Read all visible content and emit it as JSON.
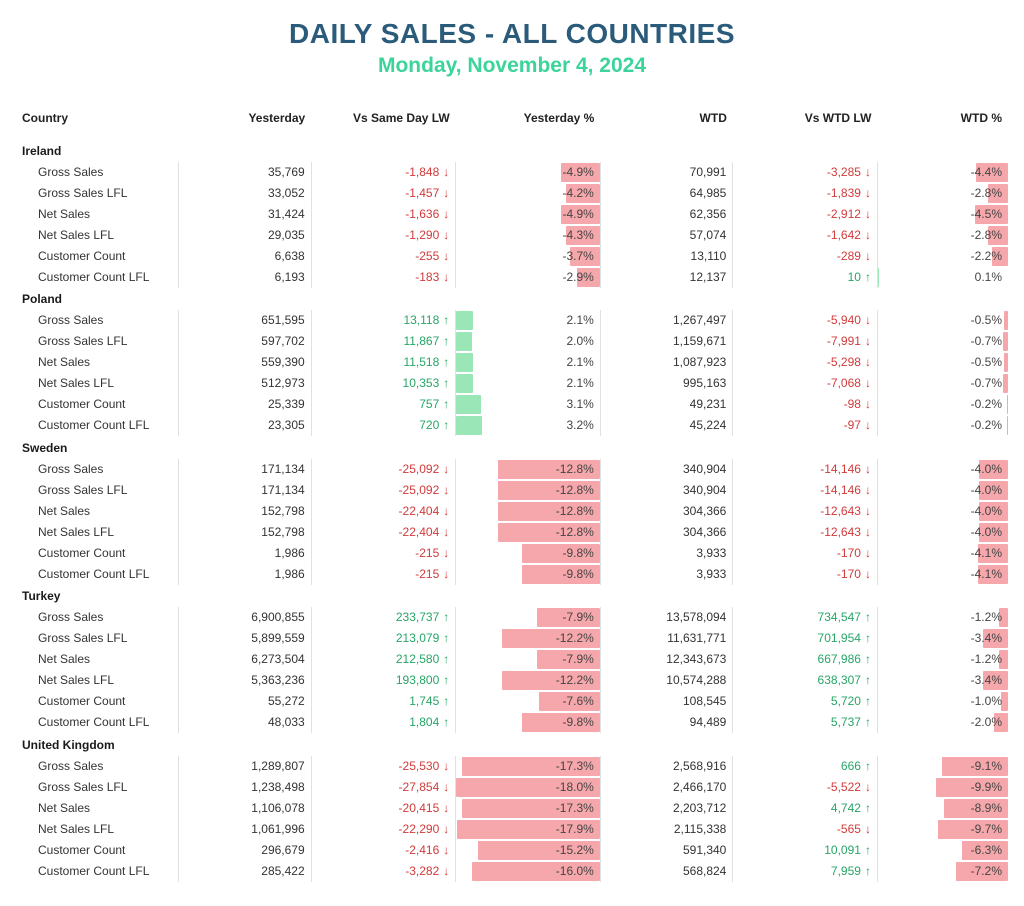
{
  "title": "DAILY SALES - ALL COUNTRIES",
  "subtitle": "Monday, November 4, 2024",
  "columns": [
    "Country",
    "Yesterday",
    "Vs Same Day LW",
    "Yesterday %",
    "WTD",
    "Vs WTD LW",
    "WTD %"
  ],
  "pct_scale_max": 18.0,
  "groups": [
    {
      "name": "Ireland",
      "rows": [
        {
          "metric": "Gross Sales",
          "yesterday": 35769,
          "vs_lw": -1848,
          "y_pct": -4.9,
          "wtd": 70991,
          "vs_wtd_lw": -3285,
          "wtd_pct": -4.4
        },
        {
          "metric": "Gross Sales LFL",
          "yesterday": 33052,
          "vs_lw": -1457,
          "y_pct": -4.2,
          "wtd": 64985,
          "vs_wtd_lw": -1839,
          "wtd_pct": -2.8
        },
        {
          "metric": "Net Sales",
          "yesterday": 31424,
          "vs_lw": -1636,
          "y_pct": -4.9,
          "wtd": 62356,
          "vs_wtd_lw": -2912,
          "wtd_pct": -4.5
        },
        {
          "metric": "Net Sales LFL",
          "yesterday": 29035,
          "vs_lw": -1290,
          "y_pct": -4.3,
          "wtd": 57074,
          "vs_wtd_lw": -1642,
          "wtd_pct": -2.8
        },
        {
          "metric": "Customer Count",
          "yesterday": 6638,
          "vs_lw": -255,
          "y_pct": -3.7,
          "wtd": 13110,
          "vs_wtd_lw": -289,
          "wtd_pct": -2.2
        },
        {
          "metric": "Customer Count LFL",
          "yesterday": 6193,
          "vs_lw": -183,
          "y_pct": -2.9,
          "wtd": 12137,
          "vs_wtd_lw": 10,
          "wtd_pct": 0.1
        }
      ]
    },
    {
      "name": "Poland",
      "rows": [
        {
          "metric": "Gross Sales",
          "yesterday": 651595,
          "vs_lw": 13118,
          "y_pct": 2.1,
          "wtd": 1267497,
          "vs_wtd_lw": -5940,
          "wtd_pct": -0.5
        },
        {
          "metric": "Gross Sales LFL",
          "yesterday": 597702,
          "vs_lw": 11867,
          "y_pct": 2.0,
          "wtd": 1159671,
          "vs_wtd_lw": -7991,
          "wtd_pct": -0.7
        },
        {
          "metric": "Net Sales",
          "yesterday": 559390,
          "vs_lw": 11518,
          "y_pct": 2.1,
          "wtd": 1087923,
          "vs_wtd_lw": -5298,
          "wtd_pct": -0.5
        },
        {
          "metric": "Net Sales LFL",
          "yesterday": 512973,
          "vs_lw": 10353,
          "y_pct": 2.1,
          "wtd": 995163,
          "vs_wtd_lw": -7068,
          "wtd_pct": -0.7
        },
        {
          "metric": "Customer Count",
          "yesterday": 25339,
          "vs_lw": 757,
          "y_pct": 3.1,
          "wtd": 49231,
          "vs_wtd_lw": -98,
          "wtd_pct": -0.2
        },
        {
          "metric": "Customer Count LFL",
          "yesterday": 23305,
          "vs_lw": 720,
          "y_pct": 3.2,
          "wtd": 45224,
          "vs_wtd_lw": -97,
          "wtd_pct": -0.2
        }
      ]
    },
    {
      "name": "Sweden",
      "rows": [
        {
          "metric": "Gross Sales",
          "yesterday": 171134,
          "vs_lw": -25092,
          "y_pct": -12.8,
          "wtd": 340904,
          "vs_wtd_lw": -14146,
          "wtd_pct": -4.0
        },
        {
          "metric": "Gross Sales LFL",
          "yesterday": 171134,
          "vs_lw": -25092,
          "y_pct": -12.8,
          "wtd": 340904,
          "vs_wtd_lw": -14146,
          "wtd_pct": -4.0
        },
        {
          "metric": "Net Sales",
          "yesterday": 152798,
          "vs_lw": -22404,
          "y_pct": -12.8,
          "wtd": 304366,
          "vs_wtd_lw": -12643,
          "wtd_pct": -4.0
        },
        {
          "metric": "Net Sales LFL",
          "yesterday": 152798,
          "vs_lw": -22404,
          "y_pct": -12.8,
          "wtd": 304366,
          "vs_wtd_lw": -12643,
          "wtd_pct": -4.0
        },
        {
          "metric": "Customer Count",
          "yesterday": 1986,
          "vs_lw": -215,
          "y_pct": -9.8,
          "wtd": 3933,
          "vs_wtd_lw": -170,
          "wtd_pct": -4.1
        },
        {
          "metric": "Customer Count LFL",
          "yesterday": 1986,
          "vs_lw": -215,
          "y_pct": -9.8,
          "wtd": 3933,
          "vs_wtd_lw": -170,
          "wtd_pct": -4.1
        }
      ]
    },
    {
      "name": "Turkey",
      "rows": [
        {
          "metric": "Gross Sales",
          "yesterday": 6900855,
          "vs_lw": 233737,
          "y_pct": -7.9,
          "wtd": 13578094,
          "vs_wtd_lw": 734547,
          "wtd_pct": -1.2
        },
        {
          "metric": "Gross Sales LFL",
          "yesterday": 5899559,
          "vs_lw": 213079,
          "y_pct": -12.2,
          "wtd": 11631771,
          "vs_wtd_lw": 701954,
          "wtd_pct": -3.4
        },
        {
          "metric": "Net Sales",
          "yesterday": 6273504,
          "vs_lw": 212580,
          "y_pct": -7.9,
          "wtd": 12343673,
          "vs_wtd_lw": 667986,
          "wtd_pct": -1.2
        },
        {
          "metric": "Net Sales LFL",
          "yesterday": 5363236,
          "vs_lw": 193800,
          "y_pct": -12.2,
          "wtd": 10574288,
          "vs_wtd_lw": 638307,
          "wtd_pct": -3.4
        },
        {
          "metric": "Customer Count",
          "yesterday": 55272,
          "vs_lw": 1745,
          "y_pct": -7.6,
          "wtd": 108545,
          "vs_wtd_lw": 5720,
          "wtd_pct": -1.0
        },
        {
          "metric": "Customer Count LFL",
          "yesterday": 48033,
          "vs_lw": 1804,
          "y_pct": -9.8,
          "wtd": 94489,
          "vs_wtd_lw": 5737,
          "wtd_pct": -2.0
        }
      ]
    },
    {
      "name": "United Kingdom",
      "rows": [
        {
          "metric": "Gross Sales",
          "yesterday": 1289807,
          "vs_lw": -25530,
          "y_pct": -17.3,
          "wtd": 2568916,
          "vs_wtd_lw": 666,
          "wtd_pct": -9.1
        },
        {
          "metric": "Gross Sales LFL",
          "yesterday": 1238498,
          "vs_lw": -27854,
          "y_pct": -18.0,
          "wtd": 2466170,
          "vs_wtd_lw": -5522,
          "wtd_pct": -9.9
        },
        {
          "metric": "Net Sales",
          "yesterday": 1106078,
          "vs_lw": -20415,
          "y_pct": -17.3,
          "wtd": 2203712,
          "vs_wtd_lw": 4742,
          "wtd_pct": -8.9
        },
        {
          "metric": "Net Sales LFL",
          "yesterday": 1061996,
          "vs_lw": -22290,
          "y_pct": -17.9,
          "wtd": 2115338,
          "vs_wtd_lw": -565,
          "wtd_pct": -9.7
        },
        {
          "metric": "Customer Count",
          "yesterday": 296679,
          "vs_lw": -2416,
          "y_pct": -15.2,
          "wtd": 591340,
          "vs_wtd_lw": 10091,
          "wtd_pct": -6.3
        },
        {
          "metric": "Customer Count LFL",
          "yesterday": 285422,
          "vs_lw": -3282,
          "y_pct": -16.0,
          "wtd": 568824,
          "vs_wtd_lw": 7959,
          "wtd_pct": -7.2
        }
      ]
    }
  ]
}
